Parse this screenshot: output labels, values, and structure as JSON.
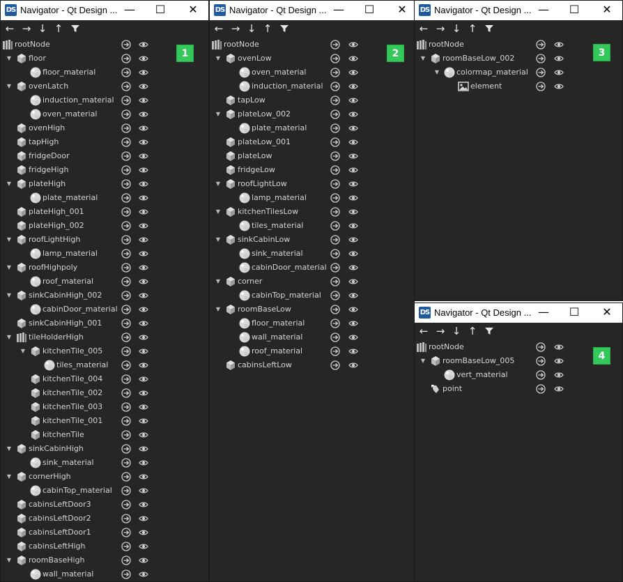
{
  "windows": [
    {
      "title": "Navigator - Qt Design ...",
      "badge": "1",
      "rows": [
        {
          "label": "rootNode",
          "icon": "scene-root-icon",
          "depth": 0,
          "expander": "none"
        },
        {
          "label": "floor",
          "icon": "model-icon",
          "depth": 1,
          "expander": "open"
        },
        {
          "label": "floor_material",
          "icon": "material-icon",
          "depth": 2,
          "expander": "none"
        },
        {
          "label": "ovenLatch",
          "icon": "model-icon",
          "depth": 1,
          "expander": "open"
        },
        {
          "label": "induction_material",
          "icon": "material-icon",
          "depth": 2,
          "expander": "none"
        },
        {
          "label": "oven_material",
          "icon": "material-icon",
          "depth": 2,
          "expander": "none"
        },
        {
          "label": "ovenHigh",
          "icon": "model-icon",
          "depth": 1,
          "expander": "none"
        },
        {
          "label": "tapHigh",
          "icon": "model-icon",
          "depth": 1,
          "expander": "none"
        },
        {
          "label": "fridgeDoor",
          "icon": "model-icon",
          "depth": 1,
          "expander": "none"
        },
        {
          "label": "fridgeHigh",
          "icon": "model-icon",
          "depth": 1,
          "expander": "none"
        },
        {
          "label": "plateHigh",
          "icon": "model-icon",
          "depth": 1,
          "expander": "open"
        },
        {
          "label": "plate_material",
          "icon": "material-icon",
          "depth": 2,
          "expander": "none"
        },
        {
          "label": "plateHigh_001",
          "icon": "model-icon",
          "depth": 1,
          "expander": "none"
        },
        {
          "label": "plateHigh_002",
          "icon": "model-icon",
          "depth": 1,
          "expander": "none"
        },
        {
          "label": "roofLightHigh",
          "icon": "model-icon",
          "depth": 1,
          "expander": "open"
        },
        {
          "label": "lamp_material",
          "icon": "material-icon",
          "depth": 2,
          "expander": "none"
        },
        {
          "label": "roofHighpoly",
          "icon": "model-icon",
          "depth": 1,
          "expander": "open"
        },
        {
          "label": "roof_material",
          "icon": "material-icon",
          "depth": 2,
          "expander": "none"
        },
        {
          "label": "sinkCabinHigh_002",
          "icon": "model-icon",
          "depth": 1,
          "expander": "open"
        },
        {
          "label": "cabinDoor_material",
          "icon": "material-icon",
          "depth": 2,
          "expander": "none"
        },
        {
          "label": "sinkCabinHigh_001",
          "icon": "model-icon",
          "depth": 1,
          "expander": "none"
        },
        {
          "label": "tileHolderHigh",
          "icon": "scene-root-icon",
          "depth": 1,
          "expander": "open"
        },
        {
          "label": "kitchenTile_005",
          "icon": "model-icon",
          "depth": 2,
          "expander": "open"
        },
        {
          "label": "tiles_material",
          "icon": "material-icon",
          "depth": 3,
          "expander": "none"
        },
        {
          "label": "kitchenTile_004",
          "icon": "model-icon",
          "depth": 2,
          "expander": "none"
        },
        {
          "label": "kitchenTile_002",
          "icon": "model-icon",
          "depth": 2,
          "expander": "none"
        },
        {
          "label": "kitchenTile_003",
          "icon": "model-icon",
          "depth": 2,
          "expander": "none"
        },
        {
          "label": "kitchenTile_001",
          "icon": "model-icon",
          "depth": 2,
          "expander": "none"
        },
        {
          "label": "kitchenTile",
          "icon": "model-icon",
          "depth": 2,
          "expander": "none"
        },
        {
          "label": "sinkCabinHigh",
          "icon": "model-icon",
          "depth": 1,
          "expander": "open"
        },
        {
          "label": "sink_material",
          "icon": "material-icon",
          "depth": 2,
          "expander": "none"
        },
        {
          "label": "cornerHigh",
          "icon": "model-icon",
          "depth": 1,
          "expander": "open"
        },
        {
          "label": "cabinTop_material",
          "icon": "material-icon",
          "depth": 2,
          "expander": "none"
        },
        {
          "label": "cabinsLeftDoor3",
          "icon": "model-icon",
          "depth": 1,
          "expander": "none"
        },
        {
          "label": "cabinsLeftDoor2",
          "icon": "model-icon",
          "depth": 1,
          "expander": "none"
        },
        {
          "label": "cabinsLeftDoor1",
          "icon": "model-icon",
          "depth": 1,
          "expander": "none"
        },
        {
          "label": "cabinsLeftHigh",
          "icon": "model-icon",
          "depth": 1,
          "expander": "none"
        },
        {
          "label": "roomBaseHigh",
          "icon": "model-icon",
          "depth": 1,
          "expander": "open"
        },
        {
          "label": "wall_material",
          "icon": "material-icon",
          "depth": 2,
          "expander": "none"
        }
      ]
    },
    {
      "title": "Navigator - Qt Design ...",
      "badge": "2",
      "rows": [
        {
          "label": "rootNode",
          "icon": "scene-root-icon",
          "depth": 0,
          "expander": "none"
        },
        {
          "label": "ovenLow",
          "icon": "model-icon",
          "depth": 1,
          "expander": "open"
        },
        {
          "label": "oven_material",
          "icon": "material-icon",
          "depth": 2,
          "expander": "none"
        },
        {
          "label": "induction_material",
          "icon": "material-icon",
          "depth": 2,
          "expander": "none"
        },
        {
          "label": "tapLow",
          "icon": "model-icon",
          "depth": 1,
          "expander": "none"
        },
        {
          "label": "plateLow_002",
          "icon": "model-icon",
          "depth": 1,
          "expander": "open"
        },
        {
          "label": "plate_material",
          "icon": "material-icon",
          "depth": 2,
          "expander": "none"
        },
        {
          "label": "plateLow_001",
          "icon": "model-icon",
          "depth": 1,
          "expander": "none"
        },
        {
          "label": "plateLow",
          "icon": "model-icon",
          "depth": 1,
          "expander": "none"
        },
        {
          "label": "fridgeLow",
          "icon": "model-icon",
          "depth": 1,
          "expander": "none"
        },
        {
          "label": "roofLightLow",
          "icon": "model-icon",
          "depth": 1,
          "expander": "open"
        },
        {
          "label": "lamp_material",
          "icon": "material-icon",
          "depth": 2,
          "expander": "none"
        },
        {
          "label": "kitchenTilesLow",
          "icon": "model-icon",
          "depth": 1,
          "expander": "open"
        },
        {
          "label": "tiles_material",
          "icon": "material-icon",
          "depth": 2,
          "expander": "none"
        },
        {
          "label": "sinkCabinLow",
          "icon": "model-icon",
          "depth": 1,
          "expander": "open"
        },
        {
          "label": "sink_material",
          "icon": "material-icon",
          "depth": 2,
          "expander": "none"
        },
        {
          "label": "cabinDoor_material",
          "icon": "material-icon",
          "depth": 2,
          "expander": "none"
        },
        {
          "label": "corner",
          "icon": "model-icon",
          "depth": 1,
          "expander": "open"
        },
        {
          "label": "cabinTop_material",
          "icon": "material-icon",
          "depth": 2,
          "expander": "none"
        },
        {
          "label": "roomBaseLow",
          "icon": "model-icon",
          "depth": 1,
          "expander": "open"
        },
        {
          "label": "floor_material",
          "icon": "material-icon",
          "depth": 2,
          "expander": "none"
        },
        {
          "label": "wall_material",
          "icon": "material-icon",
          "depth": 2,
          "expander": "none"
        },
        {
          "label": "roof_material",
          "icon": "material-icon",
          "depth": 2,
          "expander": "none"
        },
        {
          "label": "cabinsLeftLow",
          "icon": "model-icon",
          "depth": 1,
          "expander": "none"
        }
      ]
    },
    {
      "title": "Navigator - Qt Design ...",
      "badge": "3",
      "rows": [
        {
          "label": "rootNode",
          "icon": "scene-root-icon",
          "depth": 0,
          "expander": "none"
        },
        {
          "label": "roomBaseLow_002",
          "icon": "model-icon",
          "depth": 1,
          "expander": "open"
        },
        {
          "label": "colormap_material",
          "icon": "material-icon",
          "depth": 2,
          "expander": "open"
        },
        {
          "label": "element",
          "icon": "texture-icon",
          "depth": 3,
          "expander": "none"
        }
      ]
    },
    {
      "title": "Navigator - Qt Design ...",
      "badge": "4",
      "rows": [
        {
          "label": "rootNode",
          "icon": "scene-root-icon",
          "depth": 0,
          "expander": "none"
        },
        {
          "label": "roomBaseLow_005",
          "icon": "model-icon",
          "depth": 1,
          "expander": "open"
        },
        {
          "label": "vert_material",
          "icon": "material-icon",
          "depth": 2,
          "expander": "none"
        },
        {
          "label": "point",
          "icon": "point-light-icon",
          "depth": 1,
          "expander": "none"
        }
      ]
    }
  ],
  "window_buttons": {
    "minimize": "—",
    "maximize": "☐",
    "close": "✕"
  },
  "toolbar_icons": [
    "arrow-left-icon",
    "arrow-right-icon",
    "arrow-down-icon",
    "arrow-up-icon",
    "filter-icon"
  ],
  "row_action_icons": [
    "export-icon",
    "eye-icon"
  ],
  "colors": {
    "panel_bg": "#262626",
    "text": "#d4d4d4",
    "badge": "#34c759",
    "logo": "#1f5aa0"
  }
}
